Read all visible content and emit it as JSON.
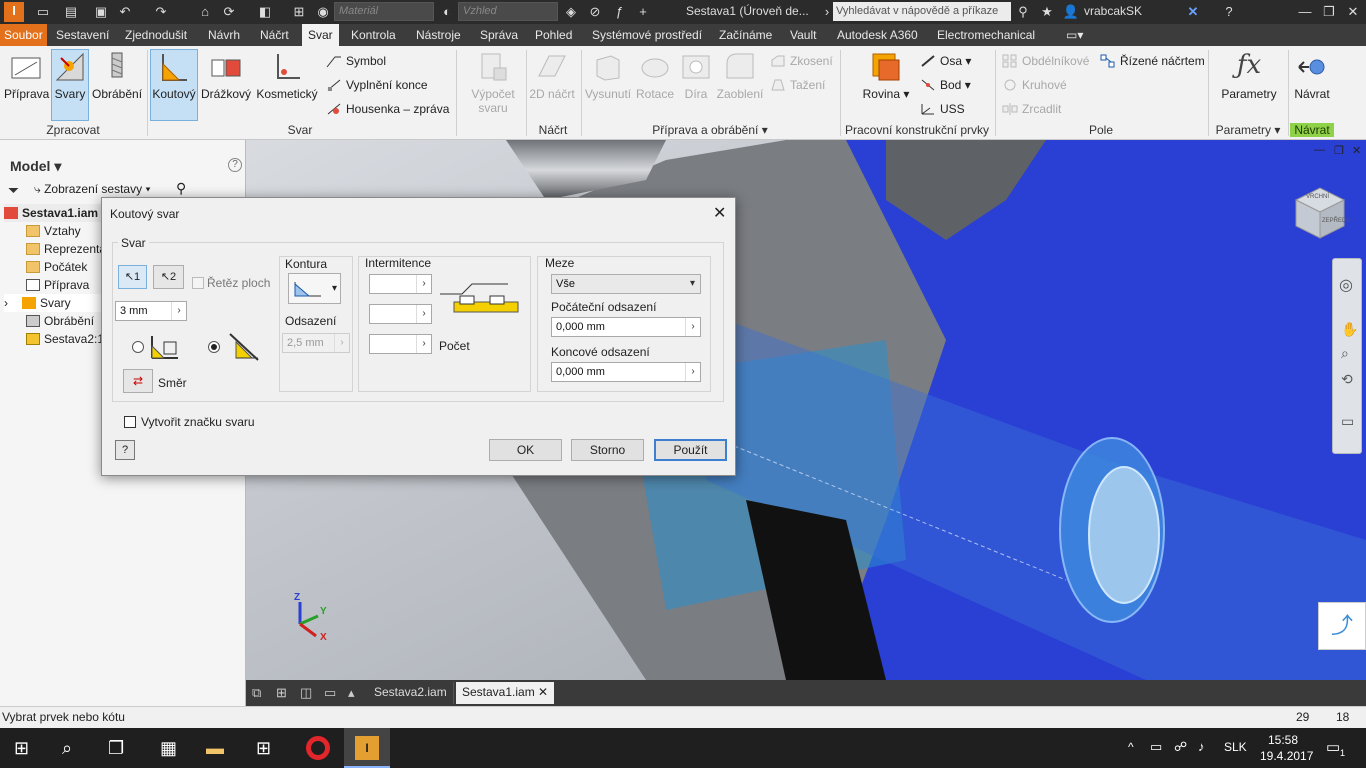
{
  "qat": {
    "material_placeholder": "Materiál",
    "appearance_placeholder": "Vzhled",
    "document_title": "Sestava1 (Úroveň de...",
    "help_search_placeholder": "Vyhledávat v nápovědě a příkaze",
    "user_name": "vrabcakSK"
  },
  "menu": {
    "tabs": [
      "Soubor",
      "Sestavení",
      "Zjednodušit",
      "Návrh",
      "Náčrt",
      "Svar",
      "Kontrola",
      "Nástroje",
      "Správa",
      "Pohled",
      "Systémové prostředí",
      "Začínáme",
      "Vault",
      "Autodesk A360",
      "Electromechanical"
    ],
    "selected": "Svar"
  },
  "ribbon": {
    "zpracovat": {
      "label": "Zpracovat",
      "buttons": [
        "Příprava",
        "Svary",
        "Obrábění"
      ]
    },
    "svar": {
      "label": "Svar",
      "buttons": [
        "Koutový",
        "Drážkový",
        "Kosmetický"
      ],
      "small": [
        "Symbol",
        "Vyplnění konce",
        "Housenka – zpráva"
      ],
      "calc_line1": "Výpočet",
      "calc_line2": "svaru"
    },
    "nacrt": {
      "label": "Náčrt",
      "buttons": [
        "2D náčrt"
      ]
    },
    "priprava": {
      "label": "Příprava a obrábění",
      "buttons": [
        "Vysunutí",
        "Rotace",
        "Díra",
        "Zaoblení"
      ],
      "small": [
        "Zkosení",
        "Tažení"
      ]
    },
    "prvky": {
      "label": "Pracovní konstrukční prvky",
      "buttons": [
        "Rovina"
      ],
      "small": [
        "Osa",
        "Bod",
        "USS"
      ]
    },
    "pole": {
      "label": "Pole",
      "small": [
        "Obdélníkové",
        "Kruhové",
        "Zrcadlit",
        "Řízené náčrtem"
      ]
    },
    "parametry": {
      "label": "Parametry",
      "buttons": [
        "Parametry"
      ]
    },
    "navrat": {
      "label": "Návrat",
      "buttons": [
        "Návrat"
      ]
    }
  },
  "browser": {
    "title": "Model",
    "view": "Zobrazení sestavy",
    "nodes": [
      "Sestava1.iam",
      "Vztahy",
      "Reprezenta",
      "Počátek",
      "Příprava",
      "Svary",
      "Obrábění",
      "Sestava2:1"
    ]
  },
  "dialog": {
    "title": "Koutový svar",
    "group": "Svar",
    "sel1": "1",
    "sel2": "2",
    "chain": "Řetěz ploch",
    "size": "3 mm",
    "direction": "Směr",
    "contour_label": "Kontura",
    "offset_label": "Odsazení",
    "offset_value": "2,5 mm",
    "intermittent_label": "Intermitence",
    "count_label": "Počet",
    "limits_label": "Meze",
    "limits_value": "Vše",
    "start_offset_label": "Počáteční odsazení",
    "start_offset_value": "0,000 mm",
    "end_offset_label": "Koncové odsazení",
    "end_offset_value": "0,000 mm",
    "create_symbol": "Vytvořit značku svaru",
    "ok": "OK",
    "cancel": "Storno",
    "apply": "Použít"
  },
  "viewcube": {
    "top_label": "VRCHNÍ",
    "front_label": "ZEPŘEDU"
  },
  "triad": {
    "x": "X",
    "y": "Y",
    "z": "Z"
  },
  "doctabs": [
    "Sestava2.iam",
    "Sestava1.iam"
  ],
  "status": {
    "prompt": "Vybrat prvek nebo kótu",
    "num1": "29",
    "num2": "18"
  },
  "taskbar": {
    "lang": "SLK",
    "time": "15:58",
    "date": "19.4.2017",
    "notifications": "1"
  },
  "colors": {
    "accent_orange": "#e3701a",
    "model_blue": "#2a3fd4",
    "dialog_bg": "#f0f0f0"
  }
}
